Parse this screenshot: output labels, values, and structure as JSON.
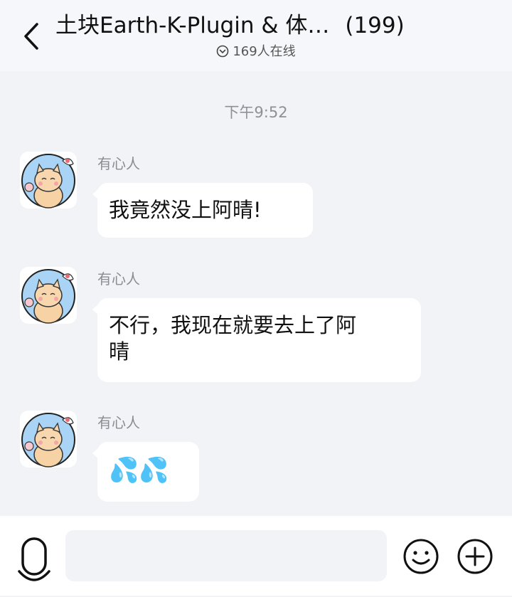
{
  "header": {
    "title": "土块Earth-K-Plugin & 体…",
    "member_count": "(199)",
    "online_text": "169人在线"
  },
  "chat": {
    "timestamp": "下午9:52",
    "messages": [
      {
        "sender": "有心人",
        "text": "我竟然没上阿晴!"
      },
      {
        "sender": "有心人",
        "text_line1": "不行，我现在就要去上了阿",
        "text_line2": "晴"
      },
      {
        "sender": "有心人",
        "text": "💦💦"
      }
    ]
  },
  "input": {
    "placeholder": ""
  },
  "colors": {
    "background": "#f2f3f7",
    "header": "#f6f7fb",
    "bubble": "#ffffff",
    "secondary_text": "#8a8c91"
  },
  "icons": [
    "back-arrow-icon",
    "chevron-circle-icon",
    "microphone-icon",
    "emoji-icon",
    "plus-icon"
  ]
}
